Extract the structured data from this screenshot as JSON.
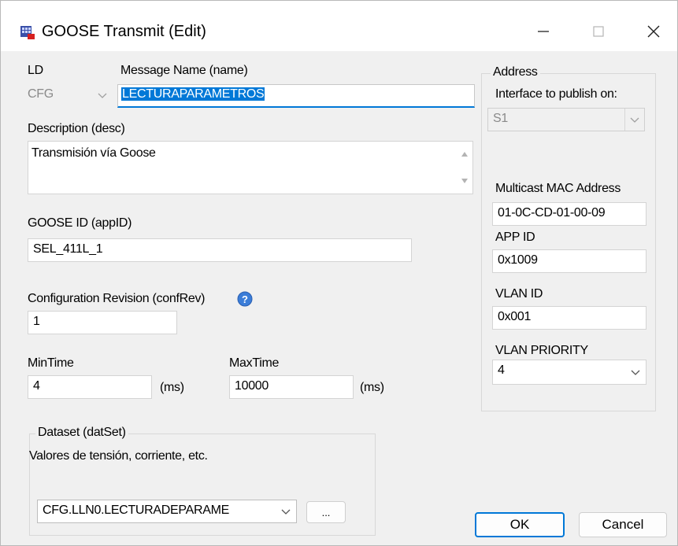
{
  "window": {
    "title": "GOOSE Transmit (Edit)"
  },
  "ld": {
    "label": "LD",
    "value": "CFG"
  },
  "message_name": {
    "label": "Message Name (name)",
    "value": "LECTURAPARAMETROS"
  },
  "description": {
    "label": "Description (desc)",
    "value": "Transmisión vía Goose"
  },
  "goose_id": {
    "label": "GOOSE ID (appID)",
    "value": "SEL_411L_1"
  },
  "conf_rev": {
    "label": "Configuration Revision (confRev)",
    "value": "1"
  },
  "min_time": {
    "label": "MinTime",
    "value": "4",
    "unit": "(ms)"
  },
  "max_time": {
    "label": "MaxTime",
    "value": "10000",
    "unit": "(ms)"
  },
  "dataset": {
    "group_title": "Dataset (datSet)",
    "description": "Valores de tensión, corriente, etc.",
    "selected": "CFG.LLN0.LECTURADEPARAME",
    "browse_label": "..."
  },
  "address": {
    "group_title": "Address",
    "interface_label": "Interface to publish on:",
    "interface_value": "S1",
    "mac_label": "Multicast MAC Address",
    "mac_value": "01-0C-CD-01-00-09",
    "appid_label": "APP ID",
    "appid_value": "0x1009",
    "vlan_id_label": "VLAN ID",
    "vlan_id_value": "0x001",
    "vlan_priority_label": "VLAN PRIORITY",
    "vlan_priority_value": "4"
  },
  "buttons": {
    "ok": "OK",
    "cancel": "Cancel"
  },
  "colors": {
    "selection": "#0078d7",
    "help_icon": "#3b7dd8"
  }
}
